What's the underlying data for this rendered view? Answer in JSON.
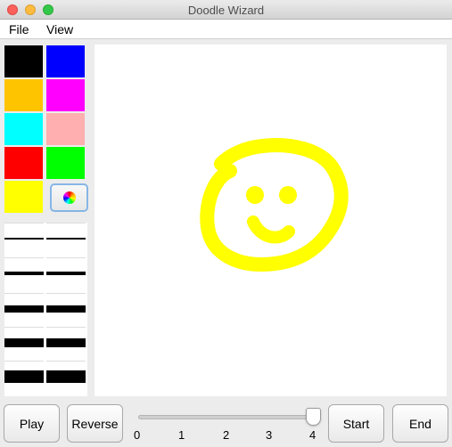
{
  "window": {
    "title": "Doodle Wizard"
  },
  "menu": {
    "file": "File",
    "view": "View"
  },
  "palette": {
    "colors": [
      "#000000",
      "#0000ff",
      "#ffc400",
      "#ff00ff",
      "#00ffff",
      "#ffafaf",
      "#ff0000",
      "#00ff00",
      "#ffff00"
    ],
    "picker_icon": "color-wheel-icon"
  },
  "stroke_widths": [
    2,
    4,
    8,
    10,
    14
  ],
  "canvas": {
    "drawing": "yellow smiley face",
    "stroke_color": "#ffff00"
  },
  "controls": {
    "play": "Play",
    "reverse": "Reverse",
    "start": "Start",
    "end": "End",
    "slider": {
      "min": 0,
      "max": 4,
      "value": 4,
      "ticks": [
        "0",
        "1",
        "2",
        "3",
        "4"
      ]
    }
  }
}
